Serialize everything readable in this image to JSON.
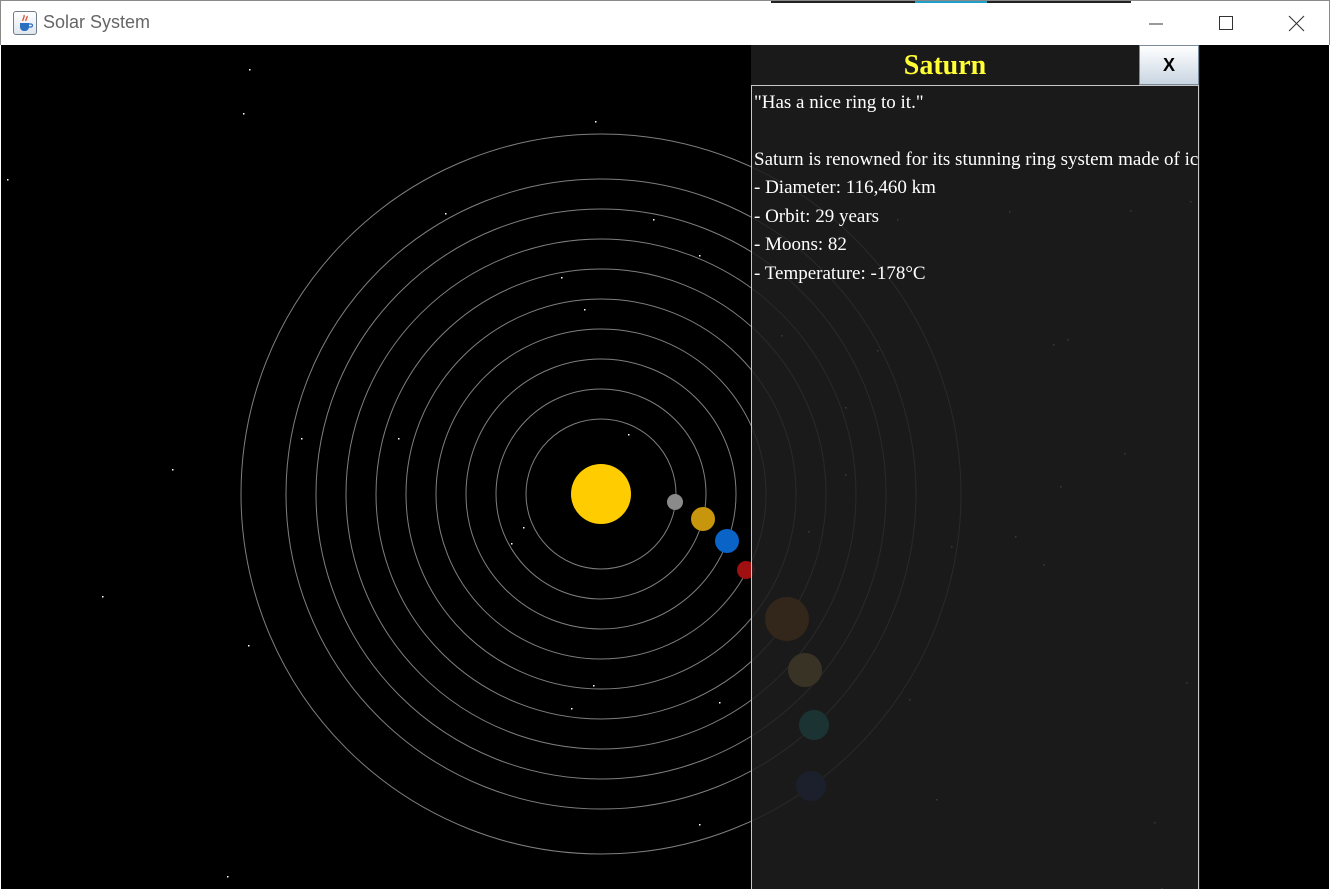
{
  "window": {
    "title": "Solar System",
    "app_icon": "java-cup-icon",
    "controls": [
      "minimize-icon",
      "maximize-icon",
      "close-icon"
    ]
  },
  "colors": {
    "space": "#000000",
    "orbit": "#7f7f7f",
    "star": "#ffffff",
    "sun": "#ffcc00",
    "panel_bg": "#1e1e1e",
    "panel_title": "#ffff33",
    "panel_text": "#ffffff"
  },
  "planets": [
    {
      "name": "mercury",
      "color": "#8a8a8a"
    },
    {
      "name": "venus",
      "color": "#c8960c"
    },
    {
      "name": "earth",
      "color": "#0a64c8"
    },
    {
      "name": "mars",
      "color": "#a01010"
    },
    {
      "name": "jupiter",
      "color": "#c8640a"
    },
    {
      "name": "saturn",
      "color": "#ffcc66"
    },
    {
      "name": "uranus",
      "color": "#10c8c8"
    },
    {
      "name": "neptune",
      "color": "#0a3296"
    }
  ],
  "info_panel": {
    "planet_name": "Saturn",
    "close_label": "X",
    "lines": [
      "\"Has a nice ring to it.\"",
      "",
      "Saturn is renowned for its stunning ring system made of ice and rock.",
      "- Diameter: 116,460 km",
      "- Orbit: 29 years",
      "- Moons: 82",
      "- Temperature: -178°C"
    ]
  }
}
